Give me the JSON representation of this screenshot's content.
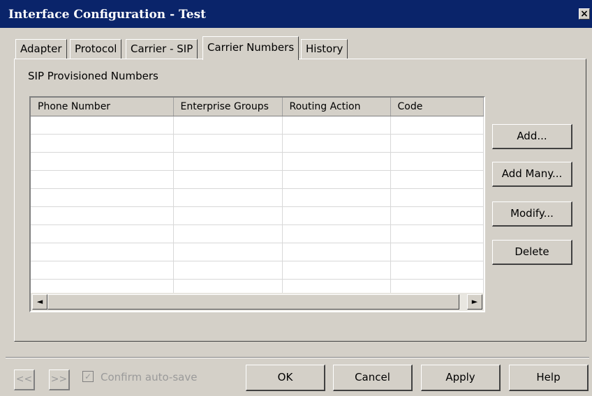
{
  "window": {
    "title": "Interface Configuration - Test",
    "close": "×"
  },
  "tabs": [
    {
      "label": "Adapter"
    },
    {
      "label": "Protocol"
    },
    {
      "label": "Carrier - SIP"
    },
    {
      "label": "Carrier Numbers",
      "active": true
    },
    {
      "label": "History"
    }
  ],
  "group_label": "SIP Provisioned Numbers",
  "table": {
    "columns": [
      "Phone Number",
      "Enterprise Groups",
      "Routing Action",
      "Code"
    ],
    "rows": []
  },
  "side_buttons": {
    "add": "Add...",
    "add_many": "Add Many...",
    "modify": "Modify...",
    "delete": "Delete"
  },
  "scrollbar": {
    "left": "◄",
    "right": "►"
  },
  "footer": {
    "prev": "<<",
    "next": ">>",
    "auto_save_label": "Confirm auto-save",
    "auto_save_checked": true,
    "check_mark": "✓",
    "ok": "OK",
    "cancel": "Cancel",
    "apply": "Apply",
    "help": "Help"
  }
}
